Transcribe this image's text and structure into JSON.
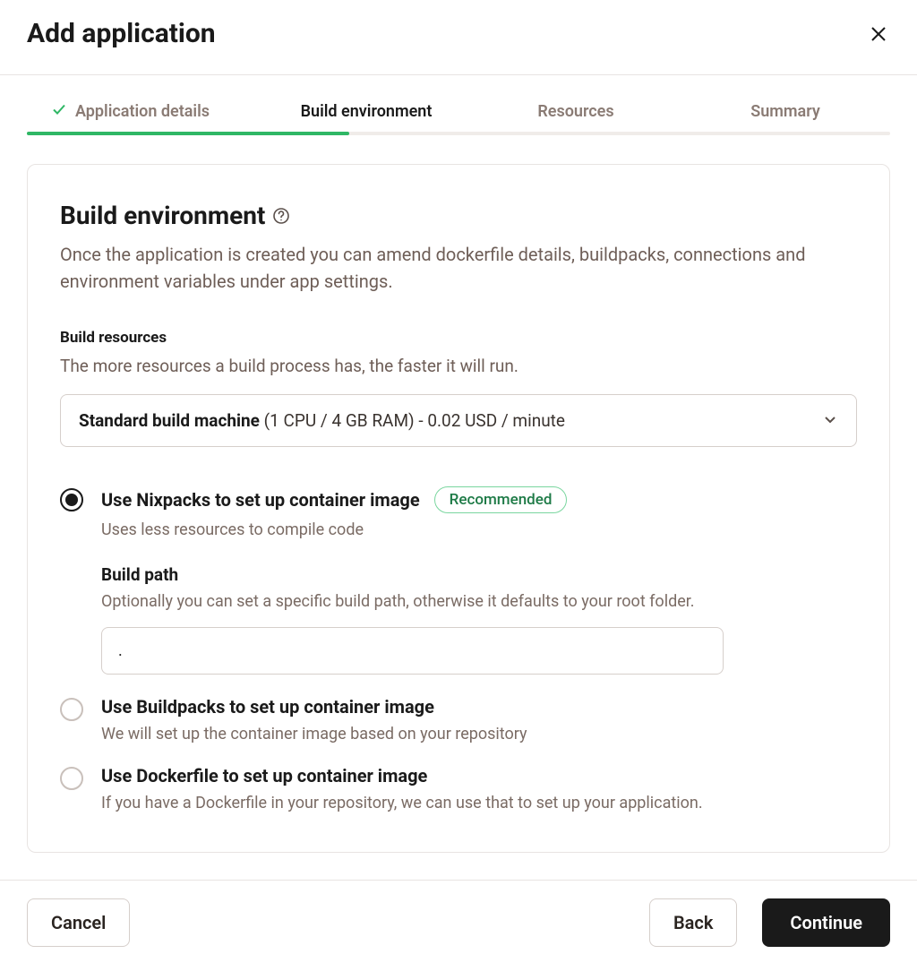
{
  "header": {
    "title": "Add application"
  },
  "stepper": {
    "steps": [
      {
        "label": "Application details",
        "state": "completed"
      },
      {
        "label": "Build environment",
        "state": "active"
      },
      {
        "label": "Resources",
        "state": "upcoming"
      },
      {
        "label": "Summary",
        "state": "upcoming"
      }
    ]
  },
  "card": {
    "title": "Build environment",
    "subtitle": "Once the application is created you can amend dockerfile details, buildpacks, connections and environment variables under app settings."
  },
  "build_resources": {
    "label": "Build resources",
    "description": "The more resources a build process has, the faster it will run.",
    "select": {
      "name_bold": "Standard build machine",
      "detail": " (1 CPU / 4 GB RAM) - 0.02 USD / minute"
    }
  },
  "options": [
    {
      "title": "Use Nixpacks to set up container image",
      "badge": "Recommended",
      "sub": "Uses less resources to compile code",
      "selected": true,
      "nested": {
        "title": "Build path",
        "desc": "Optionally you can set a specific build path, otherwise it defaults to your root folder.",
        "value": "."
      }
    },
    {
      "title": "Use Buildpacks to set up container image",
      "sub": "We will set up the container image based on your repository",
      "selected": false
    },
    {
      "title": "Use Dockerfile to set up container image",
      "sub": "If you have a Dockerfile in your repository, we can use that to set up your application.",
      "selected": false
    }
  ],
  "footer": {
    "cancel": "Cancel",
    "back": "Back",
    "continue": "Continue"
  }
}
